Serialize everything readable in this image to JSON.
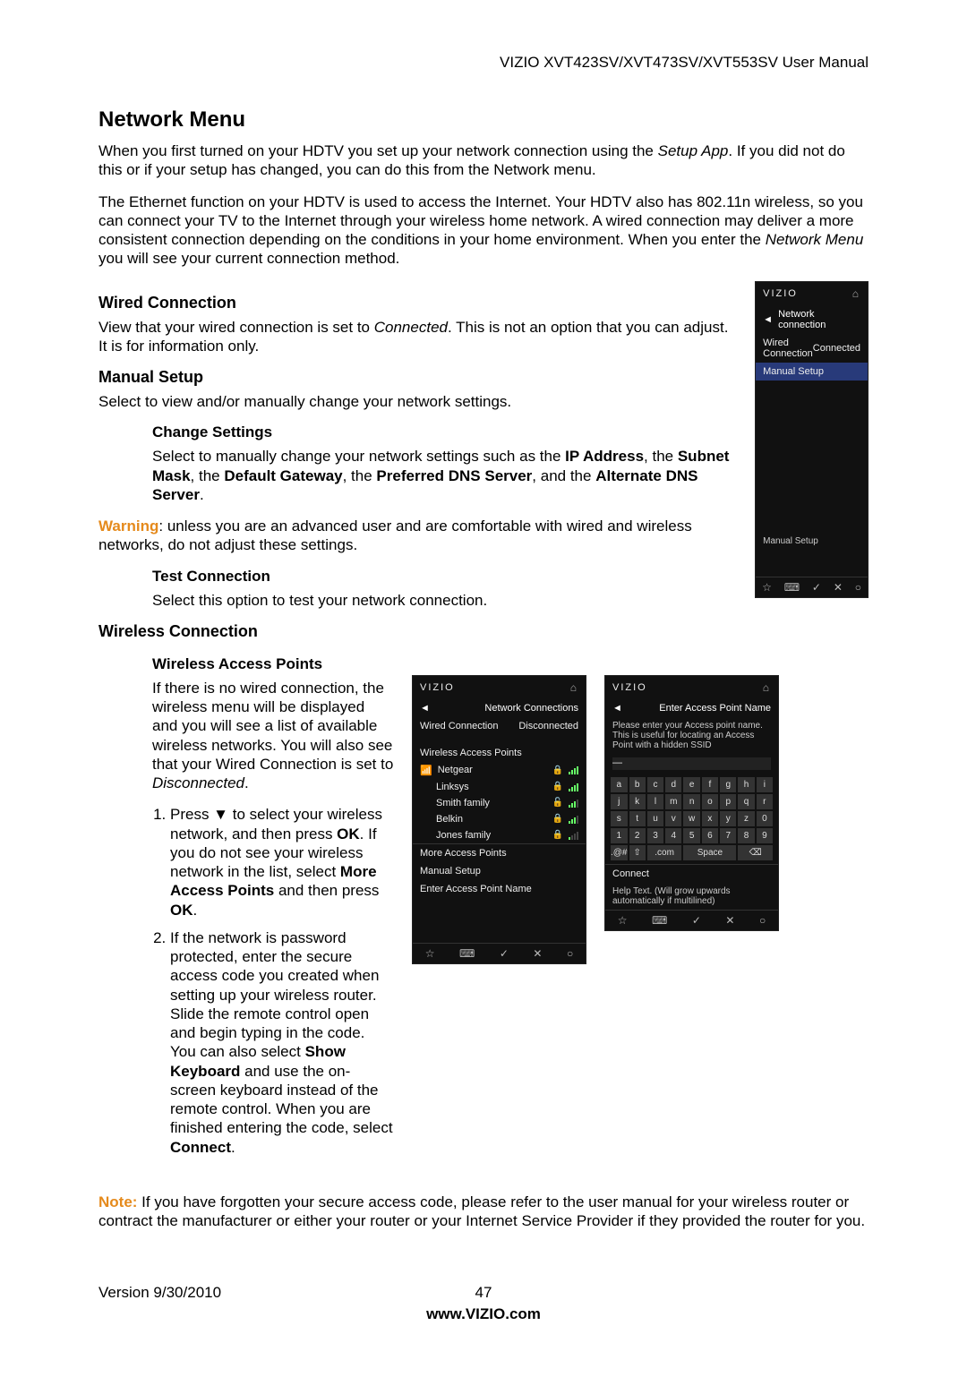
{
  "header": "VIZIO XVT423SV/XVT473SV/XVT553SV User Manual",
  "title": "Network Menu",
  "para1_a": "When you first turned on your HDTV you set up your network connection using the ",
  "para1_b": "Setup App",
  "para1_c": ". If you did not do this or if your setup has changed, you can do this from the Network menu.",
  "para2_a": "The Ethernet function on your HDTV is used to access the Internet. Your HDTV also has 802.11n wireless, so you can connect your TV to the Internet through your wireless home network. A wired connection may deliver a more consistent connection depending on the conditions in your home environment. When you enter the ",
  "para2_b": "Network Menu",
  "para2_c": " you will see your current connection method.",
  "wired_h": "Wired Connection",
  "wired_a": "View that your wired connection is set to ",
  "wired_b": "Connected",
  "wired_c": ". This is not an option that you can adjust. It is for information only.",
  "manual_h": "Manual Setup",
  "manual_p": "Select to view and/or manually change your network settings.",
  "change_h": "Change Settings",
  "change_a": "Select to manually change your network settings such as the ",
  "change_b": "IP Address",
  "change_c": ", the ",
  "change_d": "Subnet Mask",
  "change_e": ", the ",
  "change_f": "Default Gateway",
  "change_g": ", the ",
  "change_h2": "Preferred DNS Server",
  "change_i": ", and the ",
  "change_j": "Alternate DNS Server",
  "change_k": ".",
  "warn_label": "Warning",
  "warn_txt": ": unless you are an advanced user and are comfortable with wired and wireless networks, do not adjust these settings.",
  "test_h": "Test Connection",
  "test_p": "Select this option to test your network connection.",
  "wireless_h": "Wireless Connection",
  "wap_h": "Wireless Access Points",
  "wap_a": "If there is no wired connection, the wireless menu will be displayed and you will see a list of available wireless networks. You will also see that your Wired Connection is set to ",
  "wap_b": "Disconnected",
  "wap_c": ".",
  "step1_a": "Press ▼ to select your wireless network, and then press ",
  "step1_b": "OK",
  "step1_c": ". If you do not see your wireless network in the list, select ",
  "step1_d": "More Access Points",
  "step1_e": " and then press ",
  "step1_f": "OK",
  "step1_g": ".",
  "step2_a": "If the network is password protected, enter the secure access code you created when setting up your wireless router. Slide the remote control open and begin typing in the code. You can also select ",
  "step2_b": "Show Keyboard",
  "step2_c": " and use the on-screen keyboard instead of the remote control. When you are finished entering the code, select ",
  "step2_d": "Connect",
  "step2_e": ".",
  "note_label": "Note:",
  "note_txt": " If you have forgotten your secure access code, please refer to the user manual for your wireless router or contract the manufacturer or either your router or your Internet Service Provider if they provided the router for you.",
  "footer_version": "Version 9/30/2010",
  "footer_page": "47",
  "footer_site": "www.VIZIO.com",
  "shot1": {
    "brand": "VIZIO",
    "title": "Network connection",
    "wired": "Wired Connection",
    "wired_state": "Connected",
    "manual": "Manual Setup",
    "hint": "Manual Setup"
  },
  "shot2": {
    "brand": "VIZIO",
    "title": "Network Connections",
    "wired": "Wired Connection",
    "wired_state": "Disconnected",
    "wap_label": "Wireless Access Points",
    "nets": [
      "Netgear",
      "Linksys",
      "Smith family",
      "Belkin",
      "Jones family"
    ],
    "more": "More Access Points",
    "manual": "Manual Setup",
    "enter": "Enter Access Point Name"
  },
  "shot3": {
    "brand": "VIZIO",
    "title": "Enter Access Point Name",
    "help1": "Please enter your Access point name. This is useful for locating an Access Point with a hidden SSID",
    "connect": "Connect",
    "help2": "Help Text. (Will grow upwards automatically if multilined)",
    "keys_r1": [
      "a",
      "b",
      "c",
      "d",
      "e",
      "f",
      "g",
      "h",
      "i"
    ],
    "keys_r2": [
      "j",
      "k",
      "l",
      "m",
      "n",
      "o",
      "p",
      "q",
      "r"
    ],
    "keys_r3": [
      "s",
      "t",
      "u",
      "v",
      "w",
      "x",
      "y",
      "z",
      "0"
    ],
    "keys_r4": [
      "1",
      "2",
      "3",
      "4",
      "5",
      "6",
      "7",
      "8",
      "9"
    ],
    "keys_r5": [
      ".@#",
      "⇧",
      ".com",
      "Space",
      "⌫"
    ]
  }
}
